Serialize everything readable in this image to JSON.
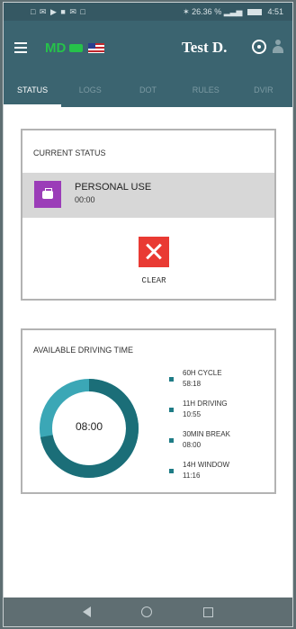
{
  "statusbar": {
    "left_icons": "□ ✉ ▶ ■ ✉ □",
    "signal": "✶ 26.36 % ▂▃▅",
    "time": "4:51"
  },
  "header": {
    "md": "MD",
    "driver_name": "Test D."
  },
  "tabs": [
    "STATUS",
    "LOGS",
    "DOT",
    "RULES",
    "DVIR"
  ],
  "current_status": {
    "title": "CURRENT STATUS",
    "status_label": "PERSONAL USE",
    "status_time": "00:00",
    "clear_label": "CLEAR",
    "status_color": "#9b3db8",
    "clear_color": "#e93a33"
  },
  "available_driving": {
    "title": "AVAILABLE DRIVING TIME",
    "gauge_value": "08:00",
    "gauge_fill": 0.72,
    "legend": [
      {
        "label": "60H CYCLE",
        "value": "58:18"
      },
      {
        "label": "11H DRIVING",
        "value": "10:55"
      },
      {
        "label": "30MIN BREAK",
        "value": "08:00"
      },
      {
        "label": "14H WINDOW",
        "value": "11:16"
      }
    ]
  },
  "colors": {
    "header": "#3b6470",
    "accent": "#1f7c86",
    "gauge_light": "#3ba7b6"
  }
}
